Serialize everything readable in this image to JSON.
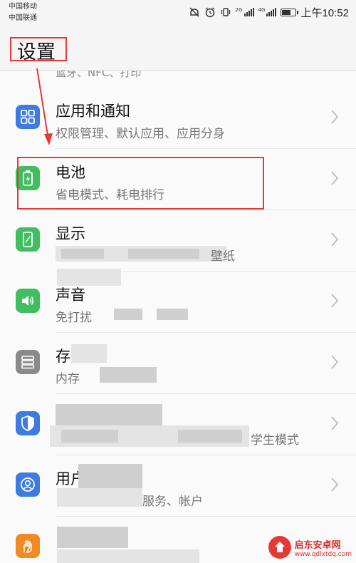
{
  "status_bar": {
    "carrier_1": "中国移动",
    "carrier_2": "中国联通",
    "network_1": "2G",
    "network_2": "4G",
    "time": "上午10:52",
    "battery_level_percent": 70,
    "icons": [
      "mute-icon",
      "alarm-icon",
      "vibrate-icon",
      "signal-icon",
      "signal-icon",
      "battery-icon"
    ]
  },
  "header": {
    "title": "设置"
  },
  "settings": {
    "partial_above": "蓝牙、NFC、打印",
    "items": [
      {
        "label": "应用和通知",
        "sub": "权限管理、默认应用、应用分身",
        "icon": "apps-grid-icon",
        "color": "#3d7be0"
      },
      {
        "label": "电池",
        "sub": "省电模式、耗电排行",
        "icon": "battery-icon",
        "color": "#3fbf5f"
      },
      {
        "label": "显示",
        "sub": "壁纸",
        "icon": "display-icon",
        "color": "#3fbf5f"
      },
      {
        "label": "声音",
        "sub": "免打扰",
        "icon": "speaker-icon",
        "color": "#3fbf5f"
      },
      {
        "label": "存储",
        "sub": "内存",
        "icon": "storage-icon",
        "color": "#8a8a8a"
      },
      {
        "label": "",
        "sub": "学生模式",
        "icon": "security-shield-icon",
        "color": "#3d7be0"
      },
      {
        "label": "用户",
        "sub": "服务、帐户",
        "icon": "user-account-icon",
        "color": "#3d7be0"
      },
      {
        "label": "",
        "sub": "",
        "icon": "assist-hand-icon",
        "color": "#f08a24"
      }
    ]
  },
  "watermark": {
    "name": "启东安卓网",
    "url": "www.qdlxtdq.com"
  }
}
